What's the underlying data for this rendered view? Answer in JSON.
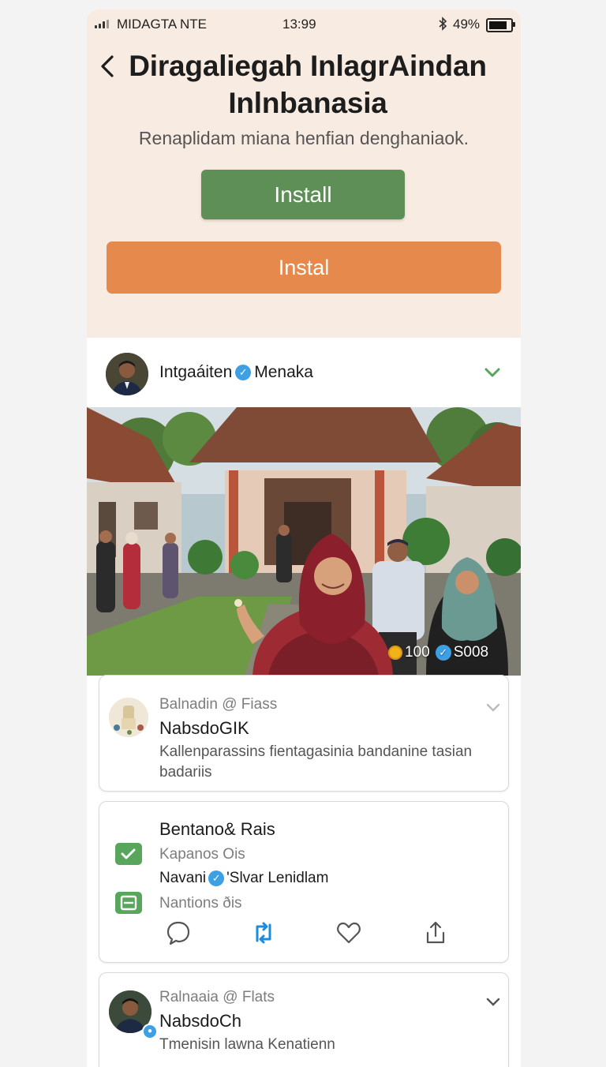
{
  "status_bar": {
    "carrier": "MIDAGTA NTE",
    "time": "13:99",
    "battery": "49%",
    "battery_level": 0.85
  },
  "header": {
    "title_line1": "Diragaliegah InlagrAindan",
    "title_line2": "Inlnbanasia",
    "subtitle": "Renaplidam miana henfian denghaniaok.",
    "primary_button": "Install",
    "secondary_button": "Instal"
  },
  "post": {
    "author": "Intgaáiten",
    "author_suffix": "Menaka",
    "photo_badge": {
      "count": "100",
      "views": "S008"
    }
  },
  "cards": [
    {
      "handle": "Balnadin @ Fiass",
      "name": "NabsdoGIK",
      "body_line1": "Kallenparassins fientagasinia bandanine tasian",
      "body_line2": "badariis"
    },
    {
      "heading": "Bentano& Rais",
      "line1": "Kapanos Ois",
      "line2_left": "Navani",
      "line2_right": "'Slvar Lenidlam",
      "line3": "Nantions ðis"
    },
    {
      "handle": "Ralnaaia @ Flats",
      "name": "NabsdoCh",
      "body_line1": "Tmenisin lawna Kenatienn"
    }
  ],
  "colors": {
    "hero_bg": "#f8ebe2",
    "green": "#5d8f57",
    "orange": "#e58a4c",
    "verified_blue": "#3ea0e4",
    "retweet_blue": "#1d8ce0"
  },
  "icons": [
    "back-chevron-icon",
    "verified-icon",
    "chevron-down-icon",
    "comment-icon",
    "retweet-icon",
    "heart-icon",
    "share-icon",
    "chat-icon",
    "list-icon"
  ]
}
